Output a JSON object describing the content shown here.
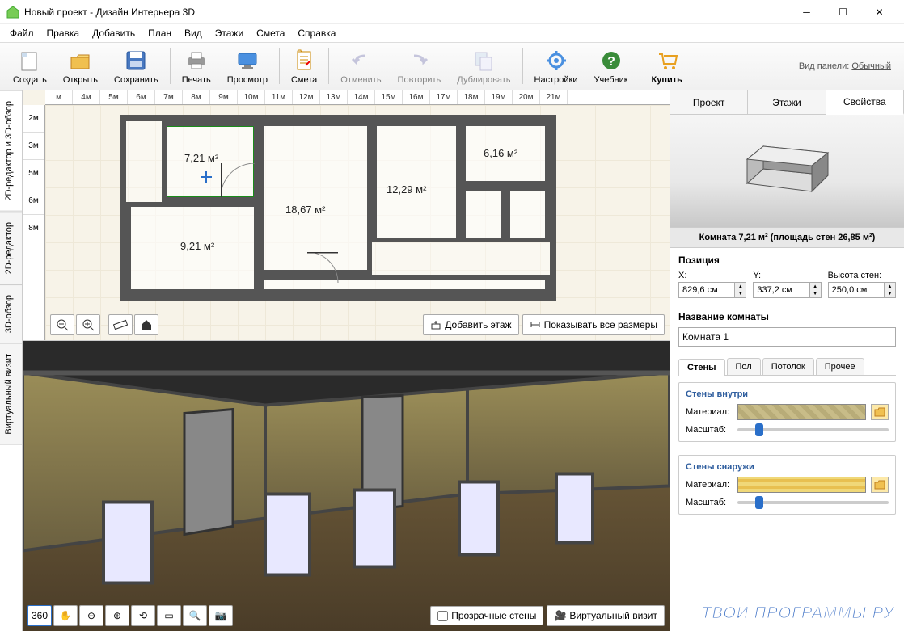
{
  "window": {
    "title": "Новый проект - Дизайн Интерьера 3D"
  },
  "menu": [
    "Файл",
    "Правка",
    "Добавить",
    "План",
    "Вид",
    "Этажи",
    "Смета",
    "Справка"
  ],
  "toolbar": [
    "Создать",
    "Открыть",
    "Сохранить",
    "Печать",
    "Просмотр",
    "Смета",
    "Отменить",
    "Повторить",
    "Дублировать",
    "Настройки",
    "Учебник",
    "Купить"
  ],
  "panelLabel": {
    "text": "Вид панели:",
    "link": "Обычный"
  },
  "sideTabs": [
    "2D-редактор и 3D-обзор",
    "2D-редактор",
    "3D-обзор",
    "Виртуальный визит"
  ],
  "rulerH": [
    "м",
    "4м",
    "5м",
    "6м",
    "7м",
    "8м",
    "9м",
    "10м",
    "11м",
    "12м",
    "13м",
    "14м",
    "15м",
    "16м",
    "17м",
    "18м",
    "19м",
    "20м",
    "21м"
  ],
  "rulerV": [
    "2м",
    "3м",
    "5м",
    "6м",
    "8м"
  ],
  "rooms": {
    "r1": "7,21 м²",
    "r2": "6,16 м²",
    "r3": "18,67 м²",
    "r4": "12,29 м²",
    "r5": "9,21 м²"
  },
  "planButtons": {
    "addFloor": "Добавить этаж",
    "showDims": "Показывать все размеры"
  },
  "render": {
    "transparentWalls": "Прозрачные стены",
    "virtualVisit": "Виртуальный визит"
  },
  "rightTabs": [
    "Проект",
    "Этажи",
    "Свойства"
  ],
  "roomInfo": "Комната 7,21 м²  (площадь стен 26,85 м²)",
  "position": {
    "title": "Позиция",
    "xLabel": "X:",
    "yLabel": "Y:",
    "hLabel": "Высота стен:",
    "x": "829,6 см",
    "y": "337,2 см",
    "h": "250,0 см"
  },
  "roomName": {
    "title": "Название комнаты",
    "value": "Комната 1"
  },
  "subTabs": [
    "Стены",
    "Пол",
    "Потолок",
    "Прочее"
  ],
  "walls": {
    "inside": {
      "title": "Стены внутри",
      "material": "Материал:",
      "scale": "Масштаб:"
    },
    "outside": {
      "title": "Стены снаружи",
      "material": "Материал:",
      "scale": "Масштаб:"
    }
  },
  "watermark": "ТВОИ ПРОГРАММЫ РУ"
}
